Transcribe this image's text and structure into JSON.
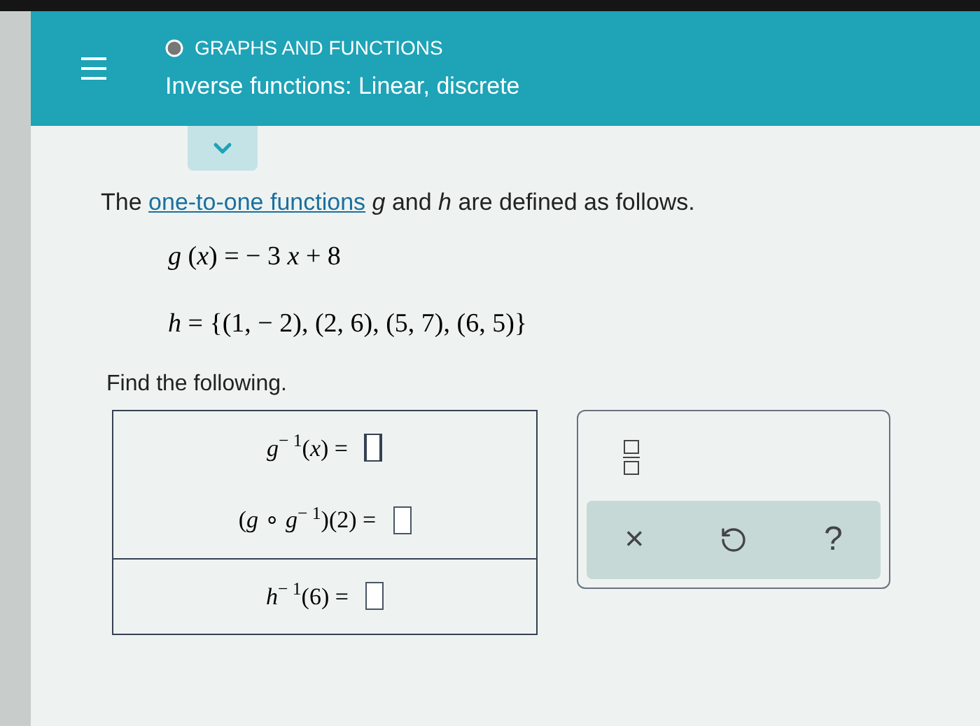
{
  "header": {
    "topic": "GRAPHS AND FUNCTIONS",
    "title": "Inverse functions: Linear, discrete"
  },
  "intro": {
    "before": "The ",
    "link": "one-to-one functions",
    "after": " *g* and *h* are defined as follows."
  },
  "equations": [
    "*g* (*x*) = − 3 *x* + 8",
    "*h* = {(1, − 2), (2, 6), (5, 7), (6, 5)}"
  ],
  "prompt": "Find the following.",
  "answer_groups": [
    [
      {
        "label": "*g*$^{− 1}$(*x*) =",
        "focused": true
      },
      {
        "label": "(*g* ∘ *g*$^{− 1}$)(2) =",
        "focused": false
      }
    ],
    [
      {
        "label": "*h*$^{− 1}$(6) =",
        "focused": false
      }
    ]
  ],
  "keypad": {
    "clear": "×",
    "help": "?"
  }
}
